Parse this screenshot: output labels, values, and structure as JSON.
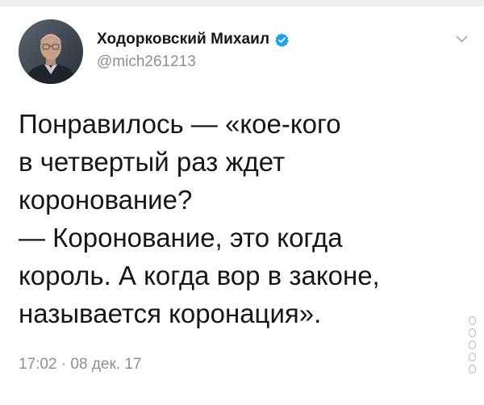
{
  "author": {
    "display_name": "Ходорковский Михаил",
    "handle": "@mich261213",
    "verified": true
  },
  "icons": {
    "avatar": "avatar-portrait",
    "verified": "verified-badge-icon",
    "menu": "chevron-down-icon"
  },
  "tweet": {
    "lines": [
      "Понравилось — «кое-кого",
      "в четвертый раз ждет",
      "коронование?",
      "— Коронование, это когда",
      "король. А когда вор в законе,",
      "называется коронация»."
    ]
  },
  "timestamp": "17:02 · 08 дек. 17",
  "colors": {
    "text": "#14171a",
    "secondary": "#8a9096",
    "verified_blue": "#1da1f2",
    "background": "#ffffff"
  }
}
